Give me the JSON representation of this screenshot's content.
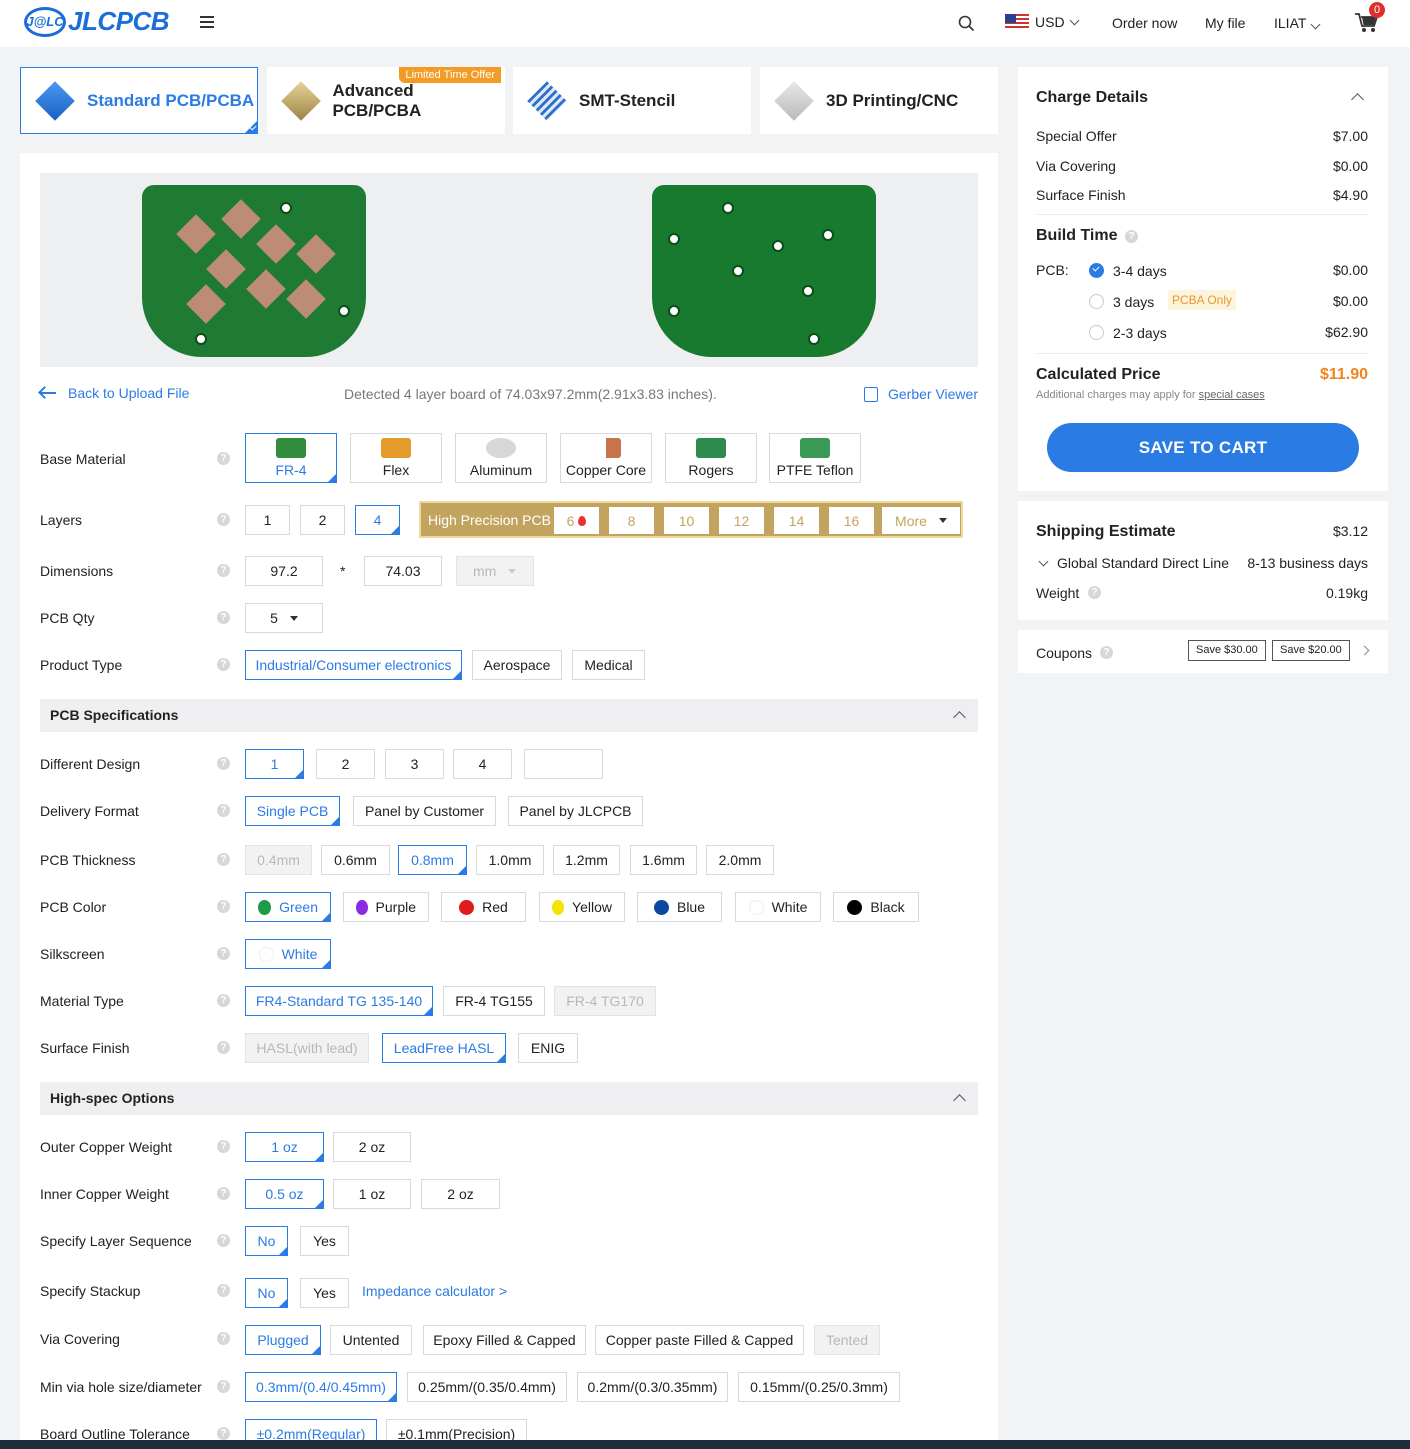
{
  "header": {
    "logo_badge": "J@LC",
    "logo_text": "JLCPCB",
    "currency": "USD",
    "order_now": "Order now",
    "my_file": "My file",
    "user": "ILIAT",
    "cart_count": "0"
  },
  "tabs": [
    {
      "label": "Standard PCB/PCBA",
      "active": true
    },
    {
      "label": "Advanced PCB/PCBA",
      "badge": "Limited Time Offer"
    },
    {
      "label": "SMT-Stencil"
    },
    {
      "label": "3D Printing/CNC"
    }
  ],
  "upload": {
    "back": "Back to Upload File",
    "detected": "Detected 4 layer board of 74.03x97.2mm(2.91x3.83 inches).",
    "gerber": "Gerber Viewer"
  },
  "form": {
    "base_material": {
      "label": "Base Material",
      "options": [
        "FR-4",
        "Flex",
        "Aluminum",
        "Copper Core",
        "Rogers",
        "PTFE Teflon"
      ],
      "selected": "FR-4"
    },
    "layers": {
      "label": "Layers",
      "options": [
        "1",
        "2",
        "4"
      ],
      "selected": "4",
      "hp_label": "High Precision PCB",
      "hp_options": [
        "6",
        "8",
        "10",
        "12",
        "14",
        "16"
      ],
      "more": "More"
    },
    "dimensions": {
      "label": "Dimensions",
      "x": "97.2",
      "sep": "*",
      "y": "74.03",
      "unit": "mm"
    },
    "qty": {
      "label": "PCB Qty",
      "value": "5"
    },
    "product_type": {
      "label": "Product Type",
      "options": [
        "Industrial/Consumer electronics",
        "Aerospace",
        "Medical"
      ],
      "selected": "Industrial/Consumer electronics"
    },
    "spec_section": "PCB Specifications",
    "different_design": {
      "label": "Different Design",
      "options": [
        "1",
        "2",
        "3",
        "4"
      ],
      "selected": "1"
    },
    "delivery_format": {
      "label": "Delivery Format",
      "options": [
        "Single PCB",
        "Panel by Customer",
        "Panel by JLCPCB"
      ],
      "selected": "Single PCB"
    },
    "thickness": {
      "label": "PCB Thickness",
      "options": [
        "0.4mm",
        "0.6mm",
        "0.8mm",
        "1.0mm",
        "1.2mm",
        "1.6mm",
        "2.0mm"
      ],
      "selected": "0.8mm",
      "disabled": "0.4mm"
    },
    "color": {
      "label": "PCB Color",
      "options": [
        "Green",
        "Purple",
        "Red",
        "Yellow",
        "Blue",
        "White",
        "Black"
      ],
      "selected": "Green",
      "swatches": [
        "#1f9a4b",
        "#8a2be2",
        "#e01b1b",
        "#f5e200",
        "#0c47a1",
        "#ffffff",
        "#000000"
      ]
    },
    "silkscreen": {
      "label": "Silkscreen",
      "value": "White"
    },
    "material_type": {
      "label": "Material Type",
      "options": [
        "FR4-Standard TG 135-140",
        "FR-4 TG155",
        "FR-4 TG170"
      ],
      "selected": "FR4-Standard TG 135-140"
    },
    "surface_finish": {
      "label": "Surface Finish",
      "options": [
        "HASL(with lead)",
        "LeadFree HASL",
        "ENIG"
      ],
      "selected": "LeadFree HASL"
    },
    "high_spec_section": "High-spec Options",
    "outer_copper": {
      "label": "Outer Copper Weight",
      "options": [
        "1 oz",
        "2 oz"
      ],
      "selected": "1 oz"
    },
    "inner_copper": {
      "label": "Inner Copper Weight",
      "options": [
        "0.5 oz",
        "1 oz",
        "2 oz"
      ],
      "selected": "0.5 oz"
    },
    "layer_sequence": {
      "label": "Specify Layer Sequence",
      "options": [
        "No",
        "Yes"
      ],
      "selected": "No"
    },
    "stackup": {
      "label": "Specify Stackup",
      "options": [
        "No",
        "Yes"
      ],
      "selected": "No",
      "link": "Impedance calculator >"
    },
    "via_covering": {
      "label": "Via Covering",
      "options": [
        "Plugged",
        "Untented",
        "Epoxy Filled & Capped",
        "Copper paste Filled & Capped",
        "Tented"
      ],
      "selected": "Plugged"
    },
    "min_via": {
      "label": "Min via hole size/diameter",
      "options": [
        "0.3mm/(0.4/0.45mm)",
        "0.25mm/(0.35/0.4mm)",
        "0.2mm/(0.3/0.35mm)",
        "0.15mm/(0.25/0.3mm)"
      ],
      "selected": "0.3mm/(0.4/0.45mm)"
    },
    "outline_tolerance": {
      "label": "Board Outline Tolerance",
      "options": [
        "±0.2mm(Regular)",
        "±0.1mm(Precision)"
      ],
      "selected": "±0.2mm(Regular)"
    }
  },
  "charge": {
    "title": "Charge Details",
    "items": [
      {
        "label": "Special Offer",
        "value": "$7.00"
      },
      {
        "label": "Via Covering",
        "value": "$0.00"
      },
      {
        "label": "Surface Finish",
        "value": "$4.90"
      }
    ],
    "build_time": "Build Time",
    "pcb_label": "PCB:",
    "build_options": [
      {
        "label": "3-4 days",
        "value": "$0.00",
        "checked": true
      },
      {
        "label": "3 days",
        "value": "$0.00",
        "tag": "PCBA Only"
      },
      {
        "label": "2-3 days",
        "value": "$62.90"
      }
    ],
    "calc_label": "Calculated Price",
    "calc_value": "$11.90",
    "note": "Additional charges may apply for",
    "note_link": "special cases",
    "save": "SAVE TO CART"
  },
  "shipping": {
    "title": "Shipping Estimate",
    "value": "$3.12",
    "method": "Global Standard Direct Line",
    "days": "8-13 business days",
    "weight_label": "Weight",
    "weight": "0.19kg"
  },
  "coupons": {
    "label": "Coupons",
    "items": [
      "Save $30.00",
      "Save $20.00"
    ]
  },
  "colors": {
    "accent": "#2b7be5",
    "price": "#f5821f",
    "gold": "#c3a45f"
  }
}
